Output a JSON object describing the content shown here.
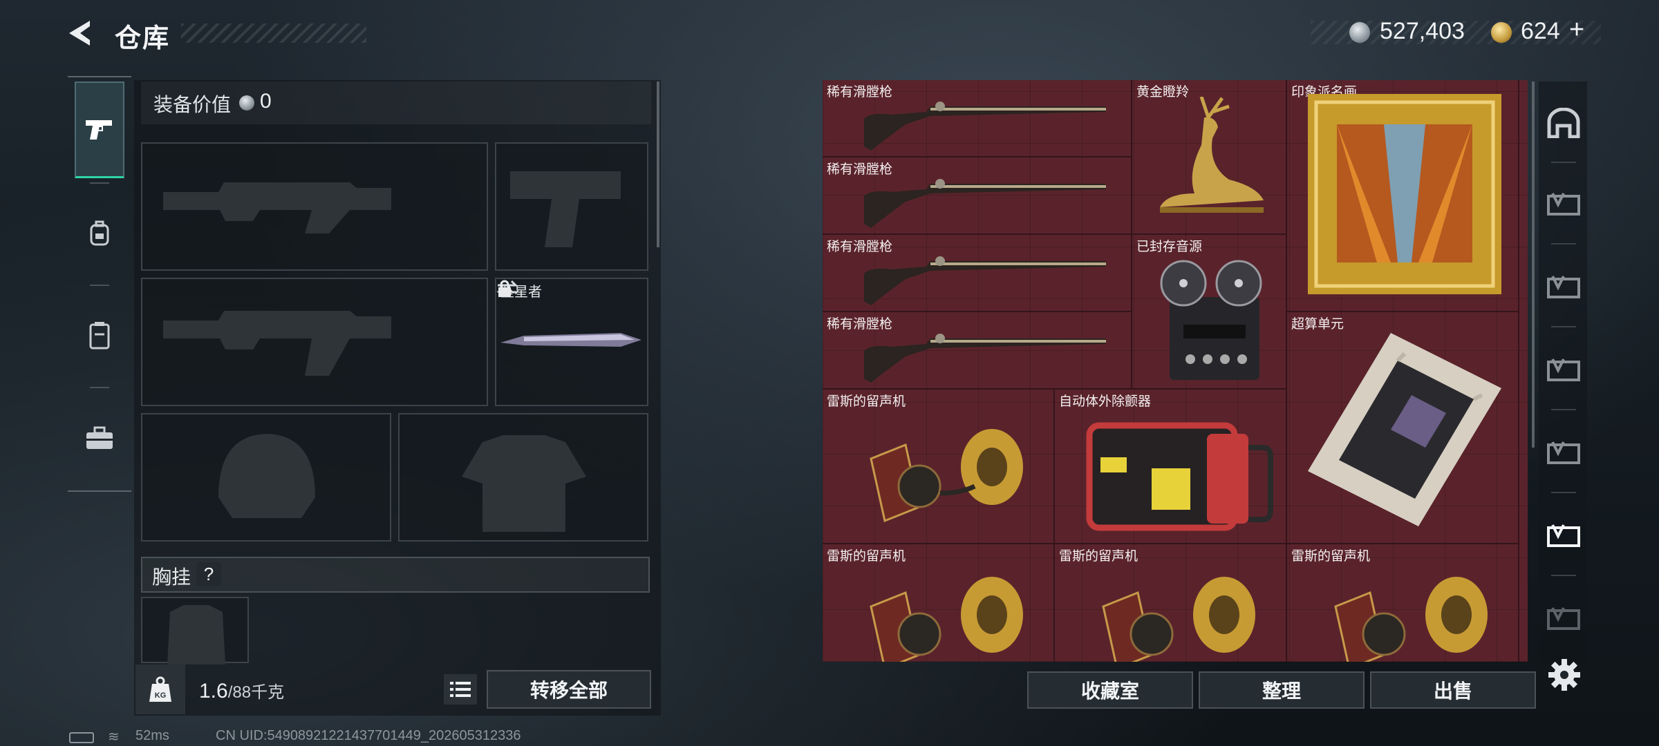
{
  "header": {
    "title": "仓库"
  },
  "currency": {
    "silver": "527,403",
    "gold": "624",
    "gold_plus": "+"
  },
  "equipment": {
    "value_label": "装备价值",
    "value": "0",
    "melee_name": "坠星者",
    "chest_label": "胸挂",
    "help": "?"
  },
  "weight": {
    "current": "1.6",
    "max": "/88千克"
  },
  "buttons": {
    "transfer_all": "转移全部",
    "collection": "收藏室",
    "organize": "整理",
    "sell": "出售"
  },
  "storage": {
    "items": [
      {
        "name": "稀有滑膛枪"
      },
      {
        "name": "稀有滑膛枪"
      },
      {
        "name": "稀有滑膛枪"
      },
      {
        "name": "稀有滑膛枪"
      },
      {
        "name": "黄金瞪羚"
      },
      {
        "name": "已封存音源"
      },
      {
        "name": "印象派名画"
      },
      {
        "name": "超算单元"
      },
      {
        "name": "雷斯的留声机"
      },
      {
        "name": "自动体外除颤器"
      },
      {
        "name": "雷斯的留声机"
      },
      {
        "name": "雷斯的留声机"
      },
      {
        "name": "雷斯的留声机"
      }
    ]
  },
  "status": {
    "ping": "52ms",
    "uid": "CN UID:5490892122143770144­9_202605312336"
  },
  "colors": {
    "accent": "#2fd6a6",
    "storage_bg": "#5a232b"
  },
  "icons": [
    "back-icon",
    "pistol-icon",
    "backpack-icon",
    "vest-icon",
    "toolbox-icon",
    "swap-icon",
    "lock-icon",
    "weight-icon",
    "list-icon",
    "gear-icon",
    "safehouse-icon",
    "voucher-icon"
  ]
}
